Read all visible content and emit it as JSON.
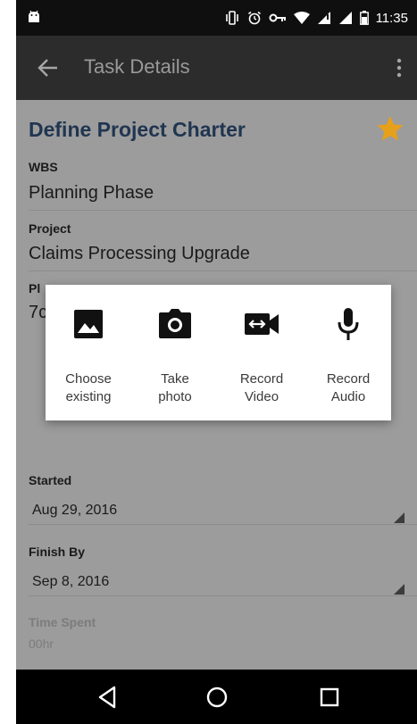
{
  "status_bar": {
    "time": "11:35",
    "icons": [
      "android-icon",
      "vibrate-icon",
      "alarm-icon",
      "vpn-key-icon",
      "wifi-icon",
      "signal-icon",
      "signal-icon-2",
      "battery-icon"
    ]
  },
  "app_bar": {
    "title": "Task Details",
    "icons": [
      "back-arrow-icon",
      "overflow-menu-icon"
    ]
  },
  "task": {
    "title": "Define Project Charter",
    "starred": true,
    "star_color": "#e6a01a",
    "wbs_label": "WBS",
    "wbs_value": "Planning Phase",
    "project_label": "Project",
    "project_value": "Claims Processing Upgrade",
    "planned_label_visible": "Pl",
    "planned_value_visible": "7c",
    "started_label": "Started",
    "started_value": "Aug 29, 2016",
    "finish_label": "Finish By",
    "finish_value": "Sep 8, 2016",
    "time_spent_label": "Time Spent",
    "time_spent_value": "00hr"
  },
  "attach_dialog": {
    "options": [
      {
        "label": "Choose\nexisting",
        "icon": "image-icon"
      },
      {
        "label": "Take\nphoto",
        "icon": "camera-icon"
      },
      {
        "label": "Record\nVideo",
        "icon": "video-camera-icon"
      },
      {
        "label": "Record\nAudio",
        "icon": "microphone-icon"
      }
    ]
  },
  "nav_bar": {
    "icons": [
      "back-triangle-icon",
      "home-circle-icon",
      "recents-square-icon"
    ]
  },
  "colors": {
    "status_bar": "#0f0f0f",
    "app_bar": "#2c2c2c",
    "scrim_content": "#9c9c9c",
    "title_text": "#203550",
    "accent_star": "#e6a01a"
  }
}
